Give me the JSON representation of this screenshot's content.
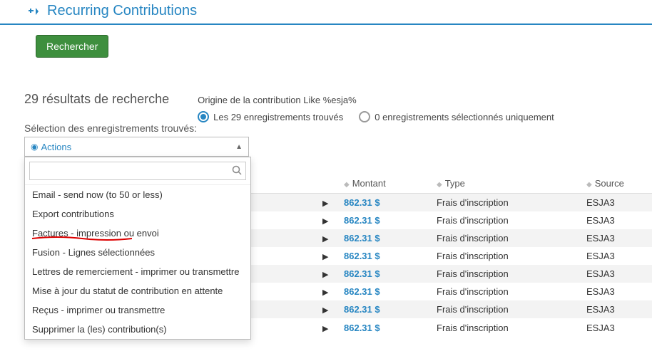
{
  "accordion": {
    "title": "Recurring Contributions"
  },
  "search_button": "Rechercher",
  "results": {
    "count_label": "29 résultats de recherche",
    "selection_label": "Sélection des enregistrements trouvés:"
  },
  "filter": {
    "origin_text": "Origine de la contribution Like %esja%",
    "radio_all": "Les 29 enregistrements trouvés",
    "radio_selected": "0 enregistrements sélectionnés uniquement"
  },
  "actions": {
    "label": "Actions",
    "items": [
      "Email - send now (to 50 or less)",
      "Export contributions",
      "Factures - impression ou envoi",
      "Fusion - Lignes sélectionnées",
      "Lettres de remerciement - imprimer ou transmettre",
      "Mise à jour du statut de contribution en attente",
      "Reçus - imprimer ou transmettre",
      "Supprimer la (les) contribution(s)"
    ],
    "highlight_index": 2
  },
  "table": {
    "headers": {
      "amount": "Montant",
      "type": "Type",
      "source": "Source"
    },
    "rows": [
      {
        "amount": "862.31 $",
        "type": "Frais d'inscription",
        "source": "ESJA3"
      },
      {
        "amount": "862.31 $",
        "type": "Frais d'inscription",
        "source": "ESJA3"
      },
      {
        "amount": "862.31 $",
        "type": "Frais d'inscription",
        "source": "ESJA3"
      },
      {
        "amount": "862.31 $",
        "type": "Frais d'inscription",
        "source": "ESJA3"
      },
      {
        "amount": "862.31 $",
        "type": "Frais d'inscription",
        "source": "ESJA3"
      },
      {
        "amount": "862.31 $",
        "type": "Frais d'inscription",
        "source": "ESJA3"
      },
      {
        "amount": "862.31 $",
        "type": "Frais d'inscription",
        "source": "ESJA3"
      },
      {
        "amount": "862.31 $",
        "type": "Frais d'inscription",
        "source": "ESJA3"
      }
    ]
  }
}
